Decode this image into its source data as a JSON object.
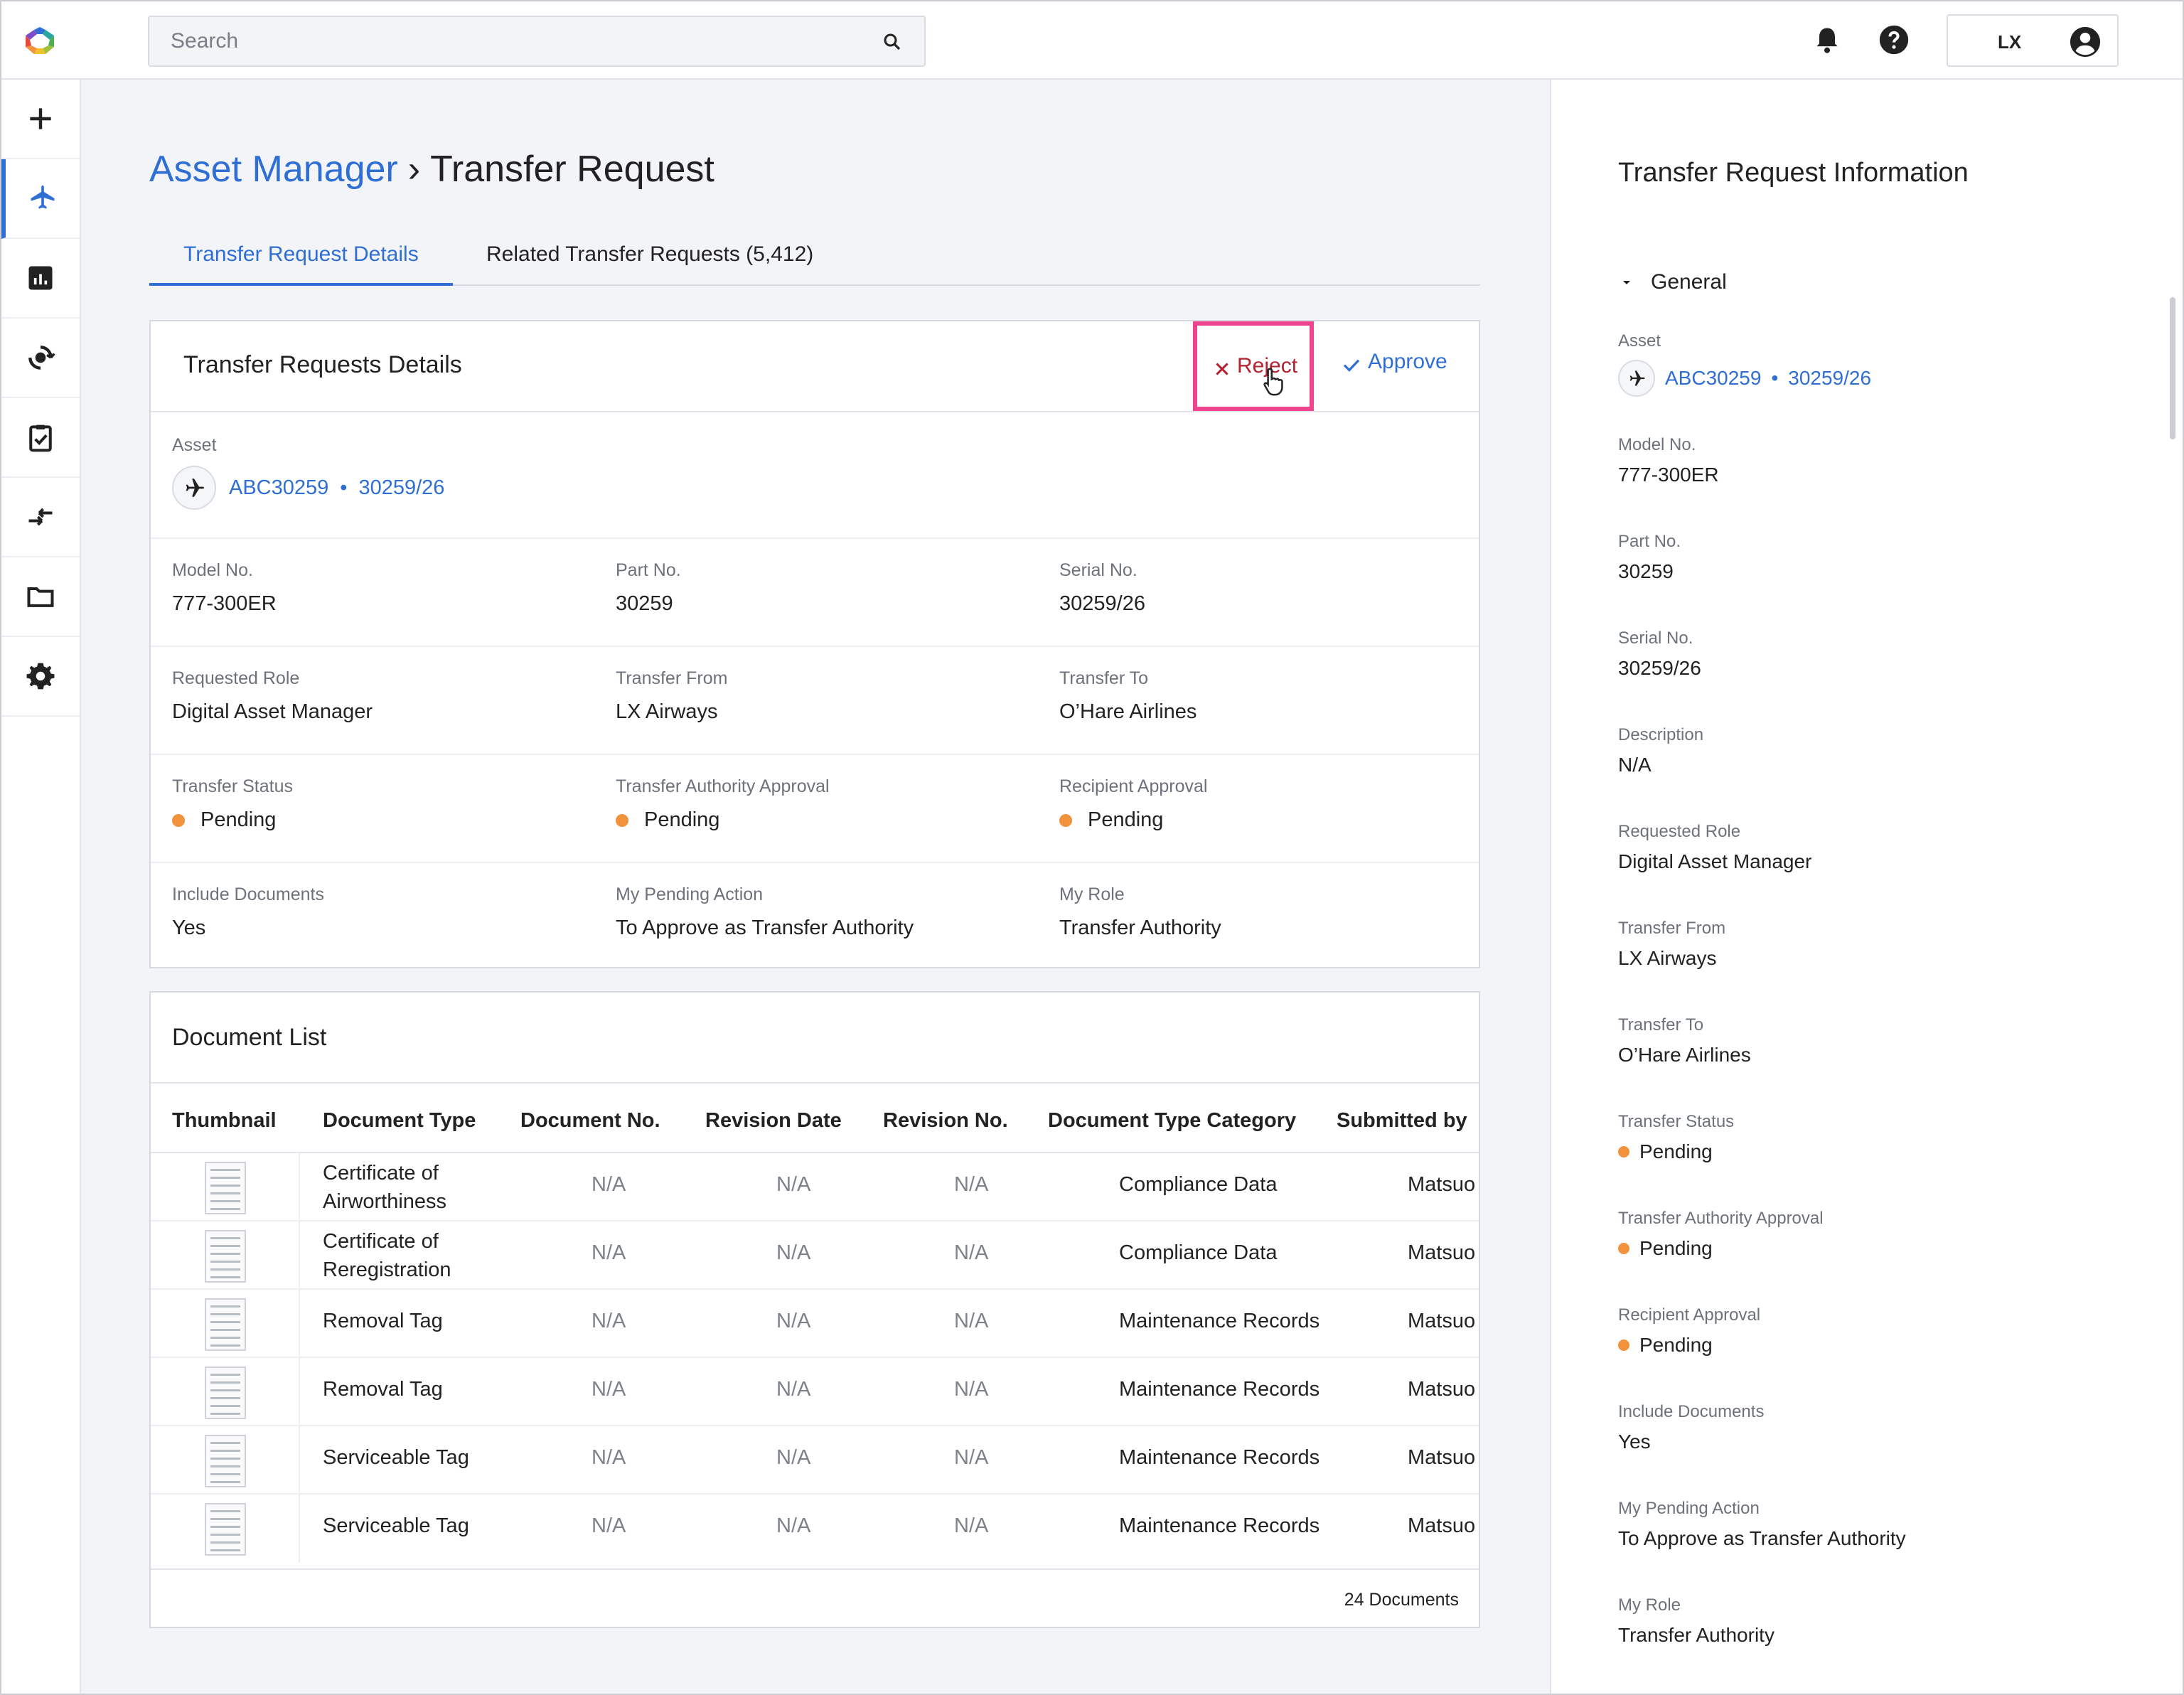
{
  "search": {
    "placeholder": "Search"
  },
  "user": {
    "initials": "LX"
  },
  "breadcrumb": {
    "parent": "Asset Manager",
    "separator": "›",
    "current": "Transfer Request"
  },
  "tabs": [
    {
      "label": "Transfer Request Details"
    },
    {
      "label": "Related Transfer Requests (5,412)"
    }
  ],
  "details": {
    "title": "Transfer Requests Details",
    "reject_label": "Reject",
    "approve_label": "Approve",
    "asset_label": "Asset",
    "asset_id": "ABC30259",
    "asset_sep": "•",
    "asset_serial": "30259/26",
    "fields": [
      {
        "label": "Model No.",
        "value": "777-300ER"
      },
      {
        "label": "Part No.",
        "value": "30259"
      },
      {
        "label": "Serial No.",
        "value": "30259/26"
      },
      {
        "label": "Requested Role",
        "value": "Digital Asset Manager"
      },
      {
        "label": "Transfer From",
        "value": "LX Airways"
      },
      {
        "label": "Transfer To",
        "value": "O’Hare Airlines"
      },
      {
        "label": "Transfer Status",
        "value": "Pending"
      },
      {
        "label": "Transfer Authority Approval",
        "value": "Pending"
      },
      {
        "label": "Recipient Approval",
        "value": "Pending"
      },
      {
        "label": "Include Documents",
        "value": "Yes"
      },
      {
        "label": "My Pending Action",
        "value": "To Approve as Transfer Authority"
      },
      {
        "label": "My Role",
        "value": "Transfer Authority"
      }
    ]
  },
  "documents": {
    "title": "Document List",
    "columns": [
      "Thumbnail",
      "Document Type",
      "Document No.",
      "Revision Date",
      "Revision No.",
      "Document Type Category",
      "Submitted by"
    ],
    "rows": [
      {
        "type": "Certificate of Airworthiness",
        "doc_no": "N/A",
        "rev_date": "N/A",
        "rev_no": "N/A",
        "category": "Compliance Data",
        "submitted_by": "Matsuo Tatsui"
      },
      {
        "type": "Certificate of Reregistration",
        "doc_no": "N/A",
        "rev_date": "N/A",
        "rev_no": "N/A",
        "category": "Compliance Data",
        "submitted_by": "Matsuo Tatsui"
      },
      {
        "type": "Removal Tag",
        "doc_no": "N/A",
        "rev_date": "N/A",
        "rev_no": "N/A",
        "category": "Maintenance Records",
        "submitted_by": "Matsuo Tatsui"
      },
      {
        "type": "Removal Tag",
        "doc_no": "N/A",
        "rev_date": "N/A",
        "rev_no": "N/A",
        "category": "Maintenance Records",
        "submitted_by": "Matsuo Tatsui"
      },
      {
        "type": "Serviceable Tag",
        "doc_no": "N/A",
        "rev_date": "N/A",
        "rev_no": "N/A",
        "category": "Maintenance Records",
        "submitted_by": "Matsuo Tatsui"
      },
      {
        "type": "Serviceable Tag",
        "doc_no": "N/A",
        "rev_date": "N/A",
        "rev_no": "N/A",
        "category": "Maintenance Records",
        "submitted_by": "Matsuo Tatsui"
      }
    ],
    "count": "24 Documents"
  },
  "panel": {
    "title": "Transfer Request Information",
    "section": "General",
    "asset_label": "Asset",
    "asset_id": "ABC30259",
    "asset_sep": "•",
    "asset_serial": "30259/26",
    "fields": [
      {
        "label": "Model No.",
        "value": "777-300ER"
      },
      {
        "label": "Part No.",
        "value": "30259"
      },
      {
        "label": "Serial No.",
        "value": "30259/26"
      },
      {
        "label": "Description",
        "value": "N/A"
      },
      {
        "label": "Requested Role",
        "value": "Digital Asset Manager"
      },
      {
        "label": "Transfer From",
        "value": "LX Airways"
      },
      {
        "label": "Transfer To",
        "value": "O’Hare Airlines"
      },
      {
        "label": "Transfer Status",
        "value": "Pending"
      },
      {
        "label": "Transfer Authority Approval",
        "value": "Pending"
      },
      {
        "label": "Recipient Approval",
        "value": "Pending"
      },
      {
        "label": "Include Documents",
        "value": "Yes"
      },
      {
        "label": "My Pending Action",
        "value": "To Approve as Transfer Authority"
      },
      {
        "label": "My Role",
        "value": "Transfer Authority"
      }
    ]
  },
  "colors": {
    "accent": "#2f6fd4",
    "pending": "#f3923c",
    "reject": "#b3232f",
    "highlight": "#f0448f"
  },
  "icons": {
    "rail": [
      "plus-icon",
      "airplane-icon",
      "chart-icon",
      "sync-icon",
      "clipboard-check-icon",
      "transfer-arrows-icon",
      "folder-icon",
      "gear-icon"
    ]
  }
}
